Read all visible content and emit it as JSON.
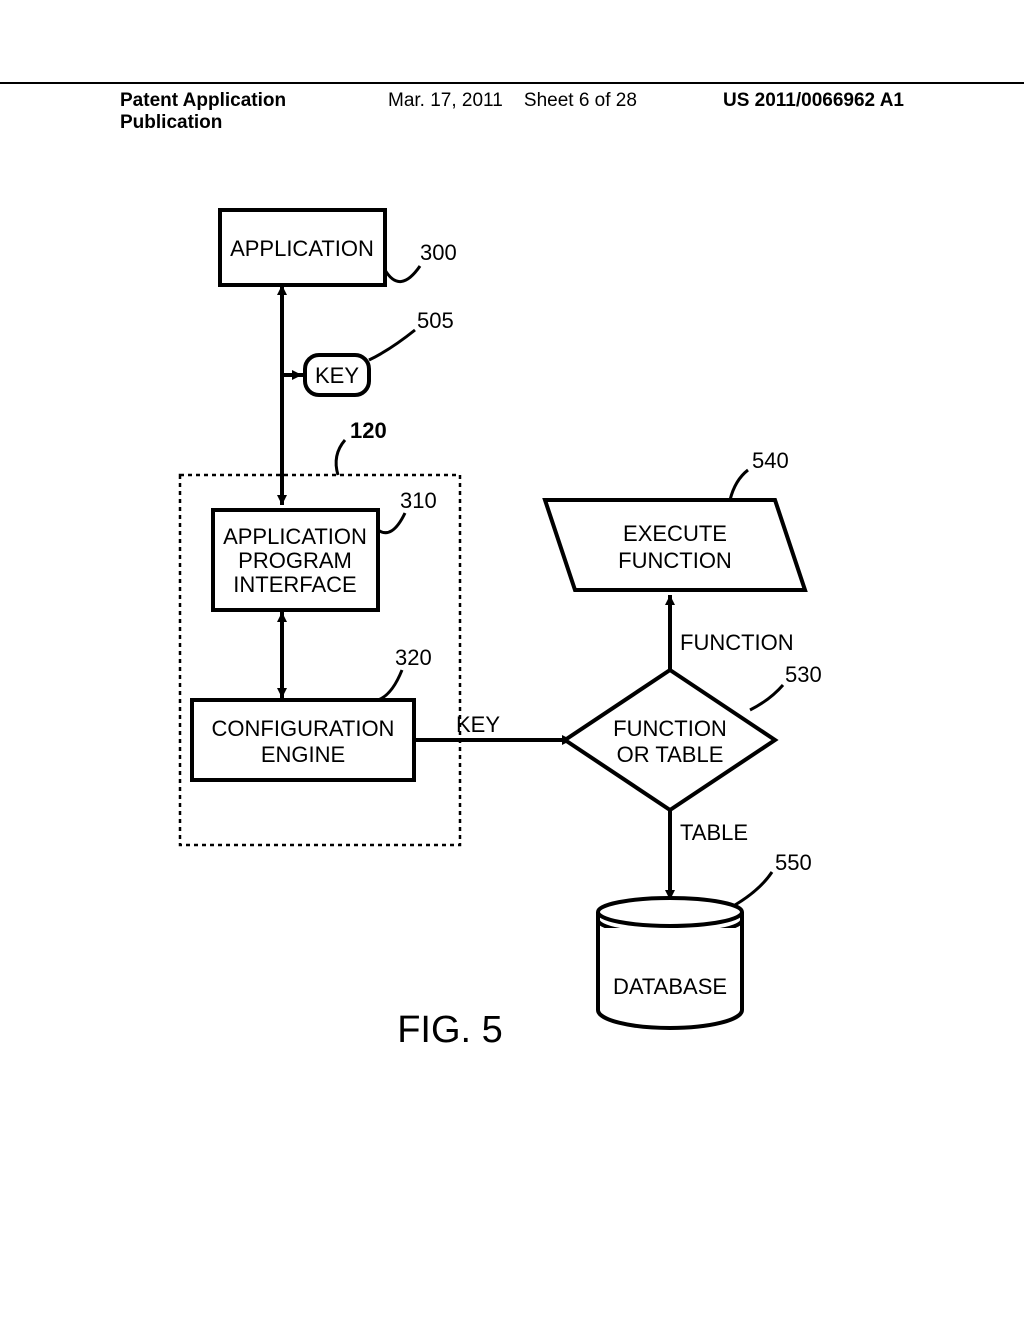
{
  "header": {
    "left": "Patent Application Publication",
    "date": "Mar. 17, 2011",
    "sheet": "Sheet 6 of 28",
    "pubno": "US 2011/0066962 A1"
  },
  "boxes": {
    "application": {
      "label": "APPLICATION",
      "ref": "300"
    },
    "key": {
      "label": "KEY",
      "ref": "505"
    },
    "container": {
      "ref": "120"
    },
    "api": {
      "line1": "APPLICATION",
      "line2": "PROGRAM",
      "line3": "INTERFACE",
      "ref": "310"
    },
    "config": {
      "line1": "CONFIGURATION",
      "line2": "ENGINE",
      "ref": "320"
    },
    "execute": {
      "line1": "EXECUTE",
      "line2": "FUNCTION",
      "ref": "540"
    },
    "decision": {
      "line1": "FUNCTION",
      "line2": "OR TABLE",
      "ref": "530"
    },
    "database": {
      "label": "DATABASE",
      "ref": "550"
    }
  },
  "edges": {
    "key_flow": "KEY",
    "function_branch": "FUNCTION",
    "table_branch": "TABLE"
  },
  "figure": "FIG. 5"
}
